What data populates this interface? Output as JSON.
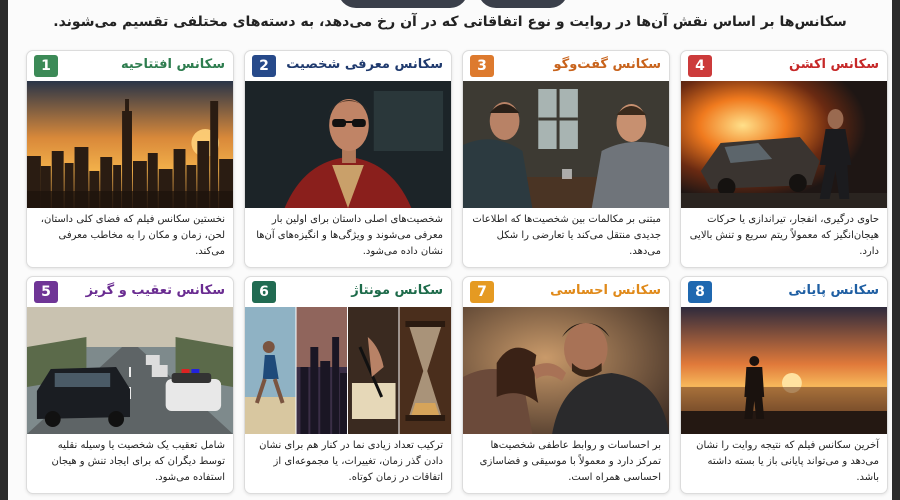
{
  "intro": "سکانس‌ها بر اساس نقش آن‌ها در روایت و نوع اتفاقاتی که در آن رخ می‌دهد، به دسته‌های مختلفی تقسیم می‌شوند.",
  "cards": [
    {
      "number": "1",
      "title": "سکانس افتتاحیه",
      "title_color": "#2e7d4f",
      "badge_color": "#3c8a57",
      "description": "نخستین سکانس فیلم که فضای کلی داستان، لحن، زمان و مکان را به مخاطب معرفی می‌کند.",
      "image": "city-skyline-sunset"
    },
    {
      "number": "2",
      "title": "سکانس معرفی شخصیت",
      "title_color": "#1f3a6e",
      "badge_color": "#274a8a",
      "description": "شخصیت‌های اصلی داستان برای اولین بار معرفی می‌شوند و ویژگی‌ها و انگیزه‌های آن‌ها نشان داده می‌شود.",
      "image": "man-red-jacket-sunglasses"
    },
    {
      "number": "3",
      "title": "سکانس گفت‌وگو",
      "title_color": "#c8631c",
      "badge_color": "#dd7a2e",
      "description": "مبتنی بر مکالمات بین شخصیت‌ها که اطلاعات جدیدی منتقل می‌کند یا تعارضی را شکل می‌دهد.",
      "image": "two-men-talking-at-table"
    },
    {
      "number": "4",
      "title": "سکانس اکشن",
      "title_color": "#c62828",
      "badge_color": "#cc3b3b",
      "description": "حاوی درگیری، انفجار، تیراندازی یا حرکات هیجان‌انگیز که معمولاً ریتم سریع و تنش بالایی دارد.",
      "image": "car-explosion-running-man"
    },
    {
      "number": "5",
      "title": "سکانس تعقیب و گریز",
      "title_color": "#6a2c91",
      "badge_color": "#6f3596",
      "description": "شامل تعقیب یک شخصیت یا وسیله نقلیه توسط دیگران که برای ایجاد تنش و هیجان استفاده می‌شود.",
      "image": "car-chase-police"
    },
    {
      "number": "6",
      "title": "سکانس مونتاژ",
      "title_color": "#1d6b4a",
      "badge_color": "#216b52",
      "description": "ترکیب تعداد زیادی نما در کنار هم برای نشان دادن گذر زمان، تغییرات، یا مجموعه‌ای از اتفاقات در زمان کوتاه.",
      "image": "montage-runner-city-writing-hourglass"
    },
    {
      "number": "7",
      "title": "سکانس احساسی",
      "title_color": "#e08a1a",
      "badge_color": "#e59a22",
      "description": "بر احساسات و روابط عاطفی شخصیت‌ها تمرکز دارد و معمولاً با موسیقی و فضاسازی احساسی همراه است.",
      "image": "couple-embrace"
    },
    {
      "number": "8",
      "title": "سکانس پایانی",
      "title_color": "#1f5fa3",
      "badge_color": "#1f68b0",
      "description": "آخرین سکانس فیلم که نتیجه روایت را نشان می‌دهد و می‌تواند پایانی باز یا بسته داشته باشد.",
      "image": "man-silhouette-sunset-sea"
    }
  ]
}
